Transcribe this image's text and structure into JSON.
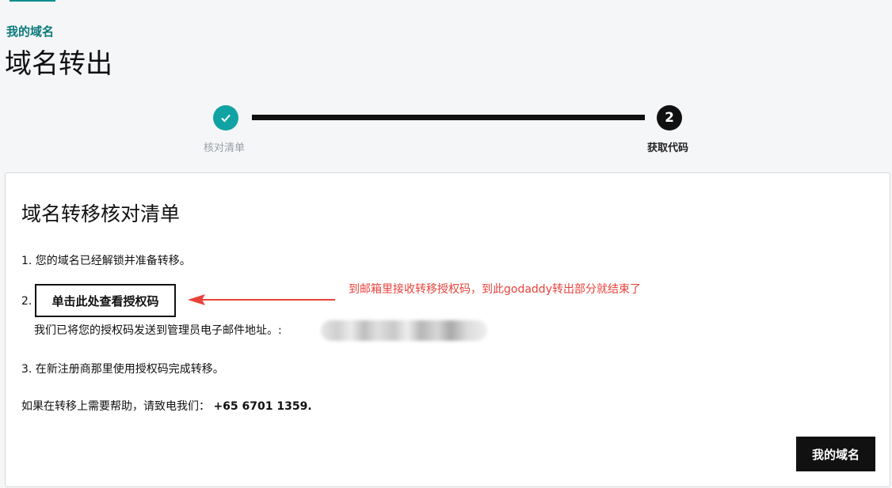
{
  "breadcrumb": {
    "label": "我的域名"
  },
  "page": {
    "title": "域名转出"
  },
  "stepper": {
    "steps": [
      {
        "label": "核对清单",
        "status": "completed",
        "icon": "check-icon"
      },
      {
        "label": "获取代码",
        "number": "2",
        "status": "current"
      }
    ]
  },
  "card": {
    "title": "域名转移核对清单",
    "item1": "1. 您的域名已经解锁并准备转移。",
    "item2_number": "2.",
    "auth_button_label": "单击此处查看授权码",
    "auth_sent_text": "我们已将您的授权码发送到管理员电子邮件地址。:",
    "item3": "3. 在新注册商那里使用授权码完成转移。",
    "help_text": "如果在转移上需要帮助，请致电我们：",
    "help_phone": "+65 6701 1359.",
    "my_domains_button": "我的域名"
  },
  "annotation": {
    "text": "到邮箱里接收转移授权码，到此godaddy转出部分就结束了",
    "color": "#e8423a"
  },
  "colors": {
    "accent": "#0a7a7a",
    "step_completed": "#11a3a3",
    "primary_button": "#111111"
  }
}
